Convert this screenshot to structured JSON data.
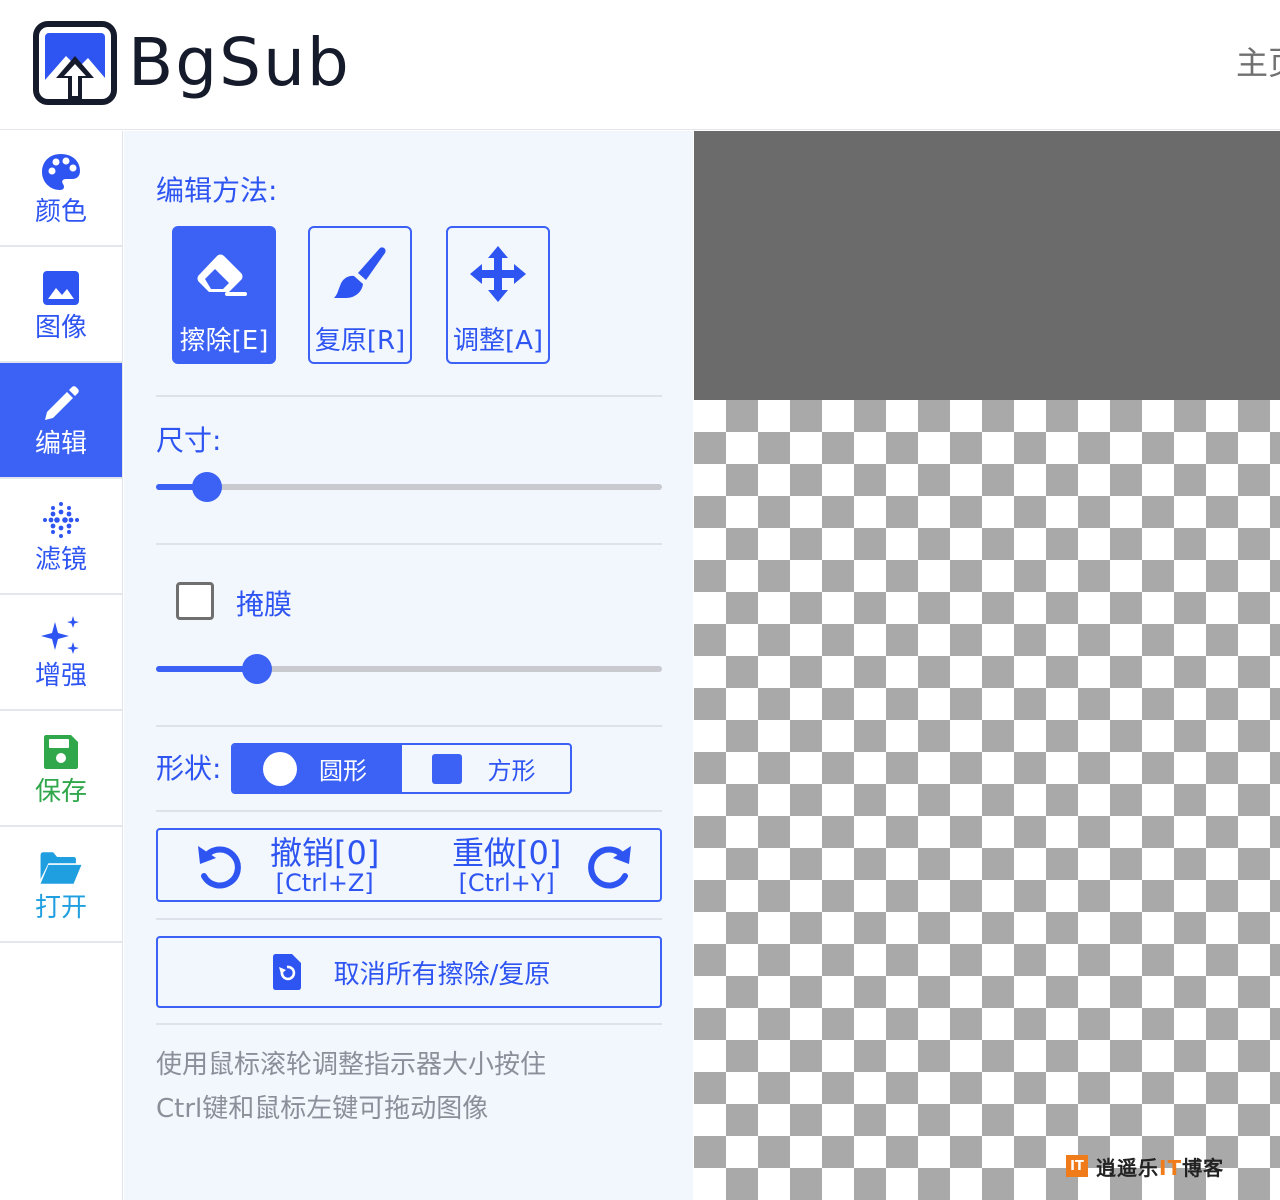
{
  "header": {
    "brand": "BgSub",
    "nav_home": "主页"
  },
  "sidebar": {
    "items": [
      {
        "label": "颜色",
        "icon": "palette-icon"
      },
      {
        "label": "图像",
        "icon": "image-icon"
      },
      {
        "label": "编辑",
        "icon": "pencil-icon",
        "active": true
      },
      {
        "label": "滤镜",
        "icon": "filter-dots-icon"
      },
      {
        "label": "增强",
        "icon": "sparkles-icon"
      },
      {
        "label": "保存",
        "icon": "save-icon"
      },
      {
        "label": "打开",
        "icon": "folder-open-icon"
      }
    ]
  },
  "panel": {
    "edit_method_title": "编辑方法:",
    "modes": [
      {
        "label": "擦除[E]",
        "icon": "eraser-icon",
        "active": true
      },
      {
        "label": "复原[R]",
        "icon": "brush-icon"
      },
      {
        "label": "调整[A]",
        "icon": "move-arrows-icon"
      }
    ],
    "size_title": "尺寸:",
    "size_slider_fraction": 0.1,
    "mask_checkbox_label": "掩膜",
    "mask_checked": false,
    "mask_slider_fraction": 0.2,
    "shape_title": "形状:",
    "shapes": [
      {
        "label": "圆形",
        "active": true
      },
      {
        "label": "方形",
        "active": false
      }
    ],
    "undo": {
      "label": "撤销[0]",
      "shortcut": "[Ctrl+Z]"
    },
    "redo": {
      "label": "重做[0]",
      "shortcut": "[Ctrl+Y]"
    },
    "reset_label": "取消所有擦除/复原",
    "hint_line1": "使用鼠标滚轮调整指示器大小按住",
    "hint_line2": "Ctrl键和鼠标左键可拖动图像"
  },
  "watermark": {
    "badge": "IT",
    "text_a": "逍遥乐",
    "text_it": "IT",
    "text_b": "博客"
  },
  "colors": {
    "accent": "#3b62f5",
    "panel_bg": "#f2f6fd",
    "save_green": "#2fa74a",
    "open_blue": "#1f9fe0",
    "canvas_gray": "#6b6b6b"
  }
}
